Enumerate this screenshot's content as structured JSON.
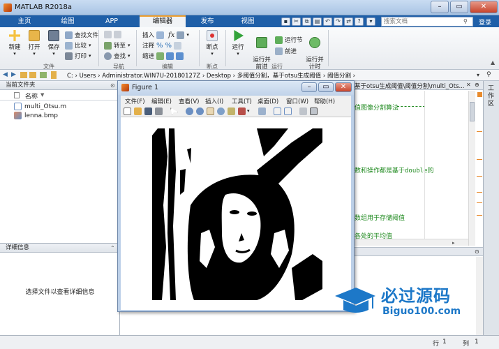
{
  "window": {
    "title": "MATLAB R2018a"
  },
  "tabs": [
    "主页",
    "绘图",
    "APP",
    "编辑器",
    "发布",
    "视图"
  ],
  "search": {
    "placeholder": "搜索文档"
  },
  "login": "登录",
  "ribbon": {
    "file": {
      "new": "新建",
      "open": "打开",
      "save": "保存",
      "find_files": "查找文件",
      "compare": "比较",
      "print": "打印",
      "group": "文件"
    },
    "nav": {
      "goto": "转至",
      "find": "查找",
      "group": "导航"
    },
    "edit": {
      "insert": "插入",
      "comment": "注释",
      "indent": "缩进",
      "fx": "fx",
      "group": "编辑"
    },
    "breakpoints": {
      "label": "断点",
      "group": "断点"
    },
    "run": {
      "run": "运行",
      "run_advance": "运行并\n前进",
      "run_section": "运行节",
      "advance": "前进",
      "run_time": "运行并\n计时",
      "group": "运行"
    }
  },
  "address": {
    "path": "C:  ›  Users  ›  Administrator.WIN7U-20180127Z  ›  Desktop  ›  多阈值分割，基于otsu生成阈值  ›  阈值分割  ›"
  },
  "filepanel": {
    "title": "当前文件夹",
    "col_name": "名称",
    "sort_arrow": "▼",
    "files": [
      "multi_Otsu.m",
      "lenna.bmp"
    ]
  },
  "details": {
    "title": "详细信息",
    "hint": "选择文件以查看详细信息"
  },
  "editor": {
    "tab": "基于otsu生成阈值\\阈值分割\\multi_Ots...",
    "lines": [
      "值图像分割算法",
      "数和操作都是基于double的",
      "数组用于存储阈值",
      "各处的平均值"
    ],
    "close": "✕",
    "expand": "⊕"
  },
  "figure": {
    "title": "Figure 1",
    "menu": [
      "文件(F)",
      "编辑(E)",
      "查看(V)",
      "插入(I)",
      "工具(T)",
      "桌面(D)",
      "窗口(W)",
      "帮助(H)"
    ],
    "controls": {
      "min": "–",
      "max": "▭",
      "close": "✕"
    }
  },
  "rightstrip": {
    "label": "工作区"
  },
  "status": {
    "row_label": "行",
    "row": "1",
    "col_label": "列",
    "col": "1"
  },
  "watermark": {
    "brand": "必过源码",
    "url": "Biguo100.com"
  },
  "colors": {
    "tab_blue": "#1f5fa8",
    "accent": "#f0a030",
    "code_green": "#228b22",
    "watermark": "#1d78c8"
  }
}
